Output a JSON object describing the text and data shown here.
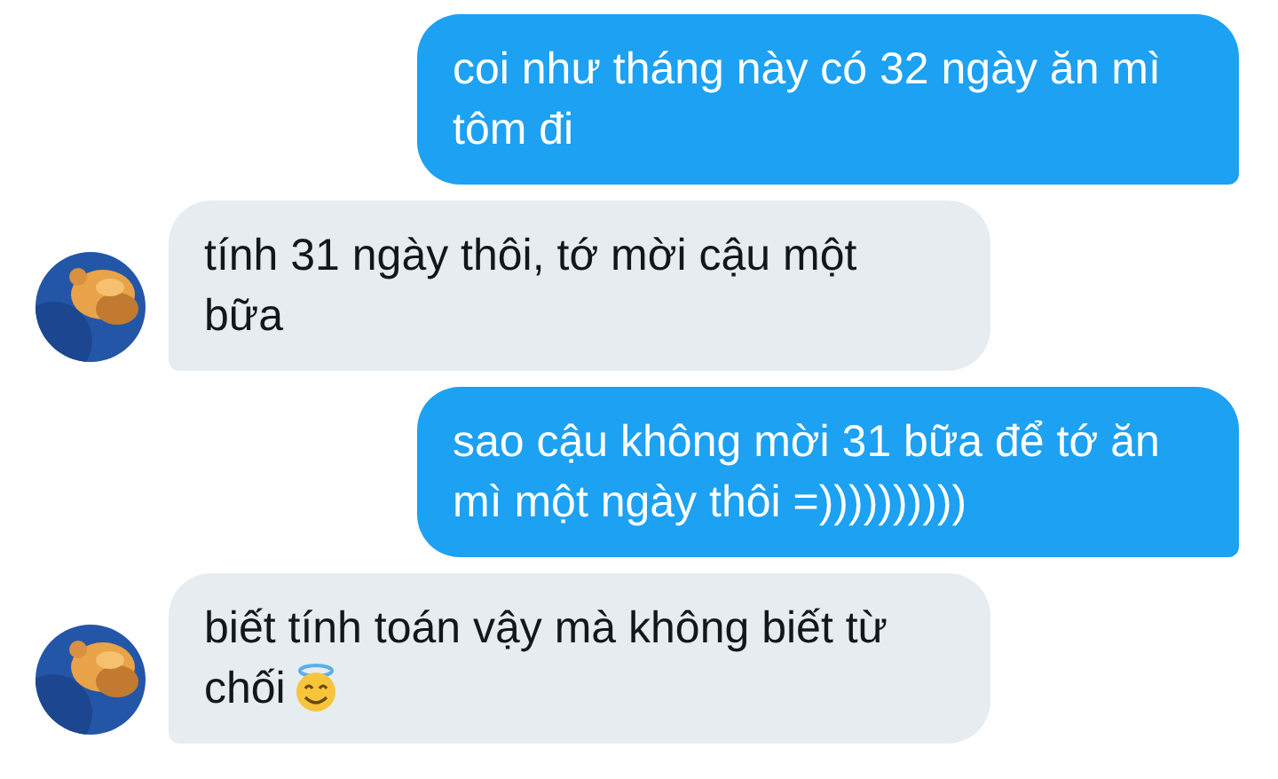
{
  "messages": [
    {
      "kind": "outgoing",
      "text": "coi như tháng này có 32 ngày ăn mì tôm đi"
    },
    {
      "kind": "incoming",
      "text": "tính 31 ngày thôi, tớ mời cậu một bữa",
      "avatar": true
    },
    {
      "kind": "outgoing",
      "text": "sao cậu không mời 31 bữa để tớ ăn mì một ngày thôi =))))))))))"
    },
    {
      "kind": "incoming",
      "text": "biết tính toán vậy mà không biết từ chối",
      "avatar": true,
      "emoji": true
    }
  ]
}
